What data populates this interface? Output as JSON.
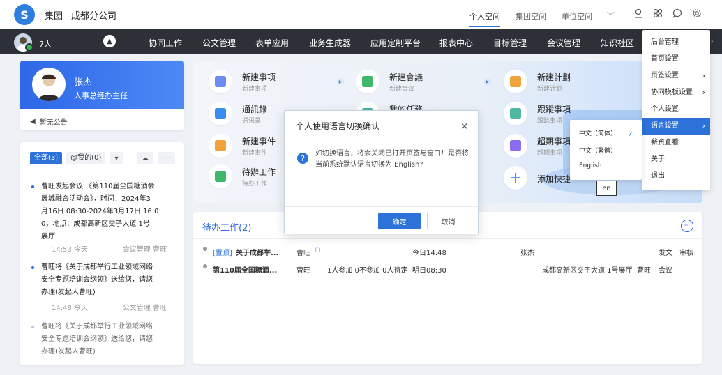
{
  "topbar": {
    "org_group": "集团",
    "org_branch": "成都分公司",
    "spaces": [
      "个人空间",
      "集团空间",
      "单位空间"
    ]
  },
  "navbar": {
    "member_count": "7人",
    "items": [
      "协同工作",
      "公文管理",
      "表单应用",
      "业务生成器",
      "应用定制平台",
      "报表中心",
      "目标管理",
      "会议管理",
      "知识社区"
    ]
  },
  "user": {
    "name": "张杰",
    "role": "人事总经办主任",
    "notice": "暂无公告"
  },
  "feed": {
    "tabs": [
      "全部(3)",
      "@我的(0)"
    ],
    "items": [
      {
        "lines": [
          "曹旺发起会议:《第110届全国糖酒会",
          "展城融合活动会》，时间：2024年3",
          "月16日 08:30-2024年3月17日 16:0",
          "0，地点：成都高新区交子大道 1号",
          "展厅"
        ],
        "time": "14:53 今天",
        "source": "会议管理 曹旺"
      },
      {
        "lines": [
          "曹旺将《关于成都举行工业领域网络",
          "安全专题培训会纲领》送给您，请您",
          "办理(发起人曹旺)"
        ],
        "time": "14:48 今天",
        "source": "公文管理 曹旺"
      },
      {
        "lines": [
          "曹旺将《关于成都举行工业领域网络",
          "安全专题培训会纲领》送给您，请您",
          "办理(发起人曹旺)"
        ]
      }
    ]
  },
  "quick": {
    "items": [
      {
        "title": "新建事项",
        "sub": "新建事项",
        "color": "#6b8cf0"
      },
      {
        "title": "新建會議",
        "sub": "新建会议",
        "color": "#3fb86e"
      },
      {
        "title": "新建計劃",
        "sub": "新建计划",
        "color": "#f1a33b"
      },
      {
        "title": "通訊錄",
        "sub": "通讯录",
        "color": "#3b8cf0"
      },
      {
        "title": "我的任務",
        "sub": "",
        "color": "#3fb8b0"
      },
      {
        "title": "跟蹤事項",
        "sub": "跟踪事项",
        "color": "#4fb8a3"
      },
      {
        "title": "新建事件",
        "sub": "新建事件",
        "color": "#f1a33b"
      },
      {
        "title": "超期事項",
        "sub": "超期事项",
        "color": "#8b6cf0"
      },
      {
        "title": "待辦工作",
        "sub": "待办工作",
        "color": "#3fb86e"
      },
      {
        "title": "添加快捷",
        "sub": "",
        "color": "#3b8cf0"
      }
    ]
  },
  "todo": {
    "title": "待办工作(2)",
    "rows": [
      {
        "tag": "[置顶]",
        "title": "关于成都举...",
        "sender": "曹旺",
        "participants": "",
        "time": "今日14:48",
        "person": "张杰",
        "location": "",
        "category": "",
        "col_a": "发文",
        "col_b": "审核"
      },
      {
        "tag": "",
        "title": "第110届全国糖酒...",
        "sender": "曹旺",
        "participants": "1人参加 0不参加 0人待定",
        "time": "明日08:30",
        "person": "",
        "location": "成都高新区交子大道 1号展厅",
        "category": "曹旺",
        "col_a": "会议",
        "col_b": ""
      }
    ]
  },
  "modal": {
    "title": "个人使用语言切换确认",
    "text": "如切换语言，将会关闭已打开页签与窗口！是否将当前系统默认语言切换为 English?",
    "ok": "确定",
    "cancel": "取消"
  },
  "settings_menu": {
    "items": [
      "后台管理",
      "首页设置",
      "页签设置",
      "协同模板设置",
      "个人设置",
      "语言设置",
      "薪资查看",
      "关于",
      "退出"
    ]
  },
  "language_menu": {
    "items": [
      "中文（简体）",
      "中文（繁體）",
      "English"
    ]
  },
  "tooltip": "en",
  "colors": {
    "primary": "#2d72d9",
    "navbar": "#2d3036"
  }
}
